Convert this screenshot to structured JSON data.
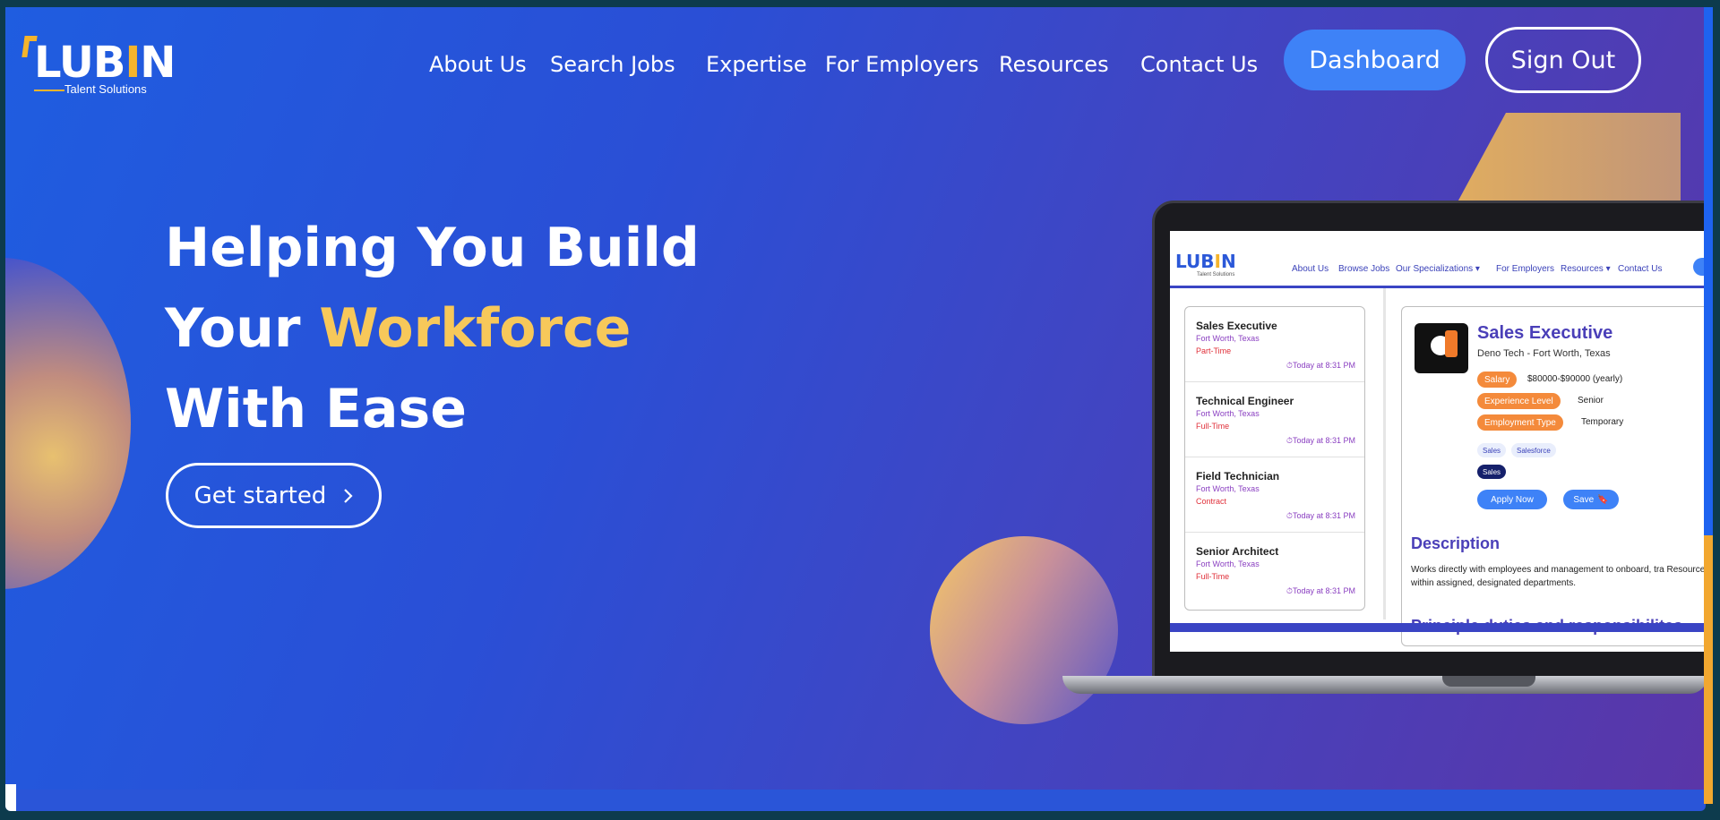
{
  "brand": {
    "name_pre": "LUB",
    "name_acc": "I",
    "name_post": "N",
    "tagline": "Talent Solutions"
  },
  "nav": {
    "items": [
      "About Us",
      "Search Jobs",
      "Expertise",
      "For Employers",
      "Resources",
      "Contact Us"
    ],
    "dashboard": "Dashboard",
    "sign_out": "Sign Out"
  },
  "hero": {
    "line1": "Helping You Build",
    "line2_pre": "Your ",
    "line2_accent": "Workforce",
    "line3": "With Ease",
    "cta": "Get started",
    "cta_icon": "chevron-right-icon"
  },
  "preview": {
    "brand": {
      "name_pre": "LUB",
      "name_acc": "I",
      "name_post": "N",
      "tagline": "Talent Solutions"
    },
    "nav": [
      "About Us",
      "Browse Jobs",
      "Our Specializations ▾",
      "For Employers",
      "Resources ▾",
      "Contact Us"
    ],
    "jobs": [
      {
        "title": "Sales Executive",
        "location": "Fort Worth, Texas",
        "type": "Part-Time",
        "time": "Today at 8:31 PM"
      },
      {
        "title": "Technical Engineer",
        "location": "Fort Worth, Texas",
        "type": "Full-Time",
        "time": "Today at 8:31 PM"
      },
      {
        "title": "Field Technician",
        "location": "Fort Worth, Texas",
        "type": "Contract",
        "time": "Today at 8:31 PM"
      },
      {
        "title": "Senior Architect",
        "location": "Fort Worth, Texas",
        "type": "Full-Time",
        "time": "Today at 8:31 PM"
      }
    ],
    "detail": {
      "title": "Sales Executive",
      "company": "Deno Tech - Fort Worth, Texas",
      "salary_label": "Salary",
      "salary_value": "$80000-$90000 (yearly)",
      "exp_label": "Experience Level",
      "exp_value": "Senior",
      "emp_label": "Employment Type",
      "emp_value": "Temporary",
      "tags": [
        "Sales",
        "Salesforce"
      ],
      "category": "Sales",
      "apply": "Apply Now",
      "save": "Save",
      "desc_heading": "Description",
      "desc_text": "Works directly with employees and management to onboard, tra Resources within assigned, designated departments.",
      "duties_heading": "Principle duties and responsibilites"
    }
  },
  "colors": {
    "accent": "#f7c85a",
    "button_blue": "#3e82f7",
    "brand_orange": "#f5b42c"
  }
}
